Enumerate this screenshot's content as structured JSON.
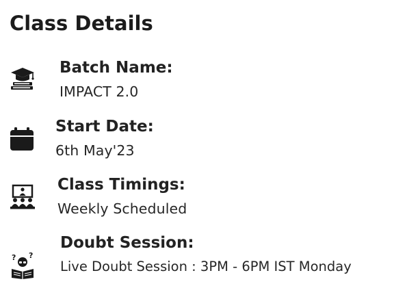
{
  "section": {
    "title": "Class Details"
  },
  "items": [
    {
      "label": "Batch Name:",
      "value": "IMPACT 2.0",
      "icon": "graduation-cap-books-icon"
    },
    {
      "label": "Start Date:",
      "value": "6th May'23",
      "icon": "calendar-icon"
    },
    {
      "label": "Class Timings:",
      "value": "Weekly Scheduled",
      "icon": "classroom-icon"
    },
    {
      "label": "Doubt Session:",
      "value": "Live Doubt Session : 3PM - 6PM IST Monday",
      "icon": "student-question-icon"
    }
  ],
  "colors": {
    "text": "#222222",
    "icon": "#1a1a1a",
    "background": "#ffffff"
  }
}
